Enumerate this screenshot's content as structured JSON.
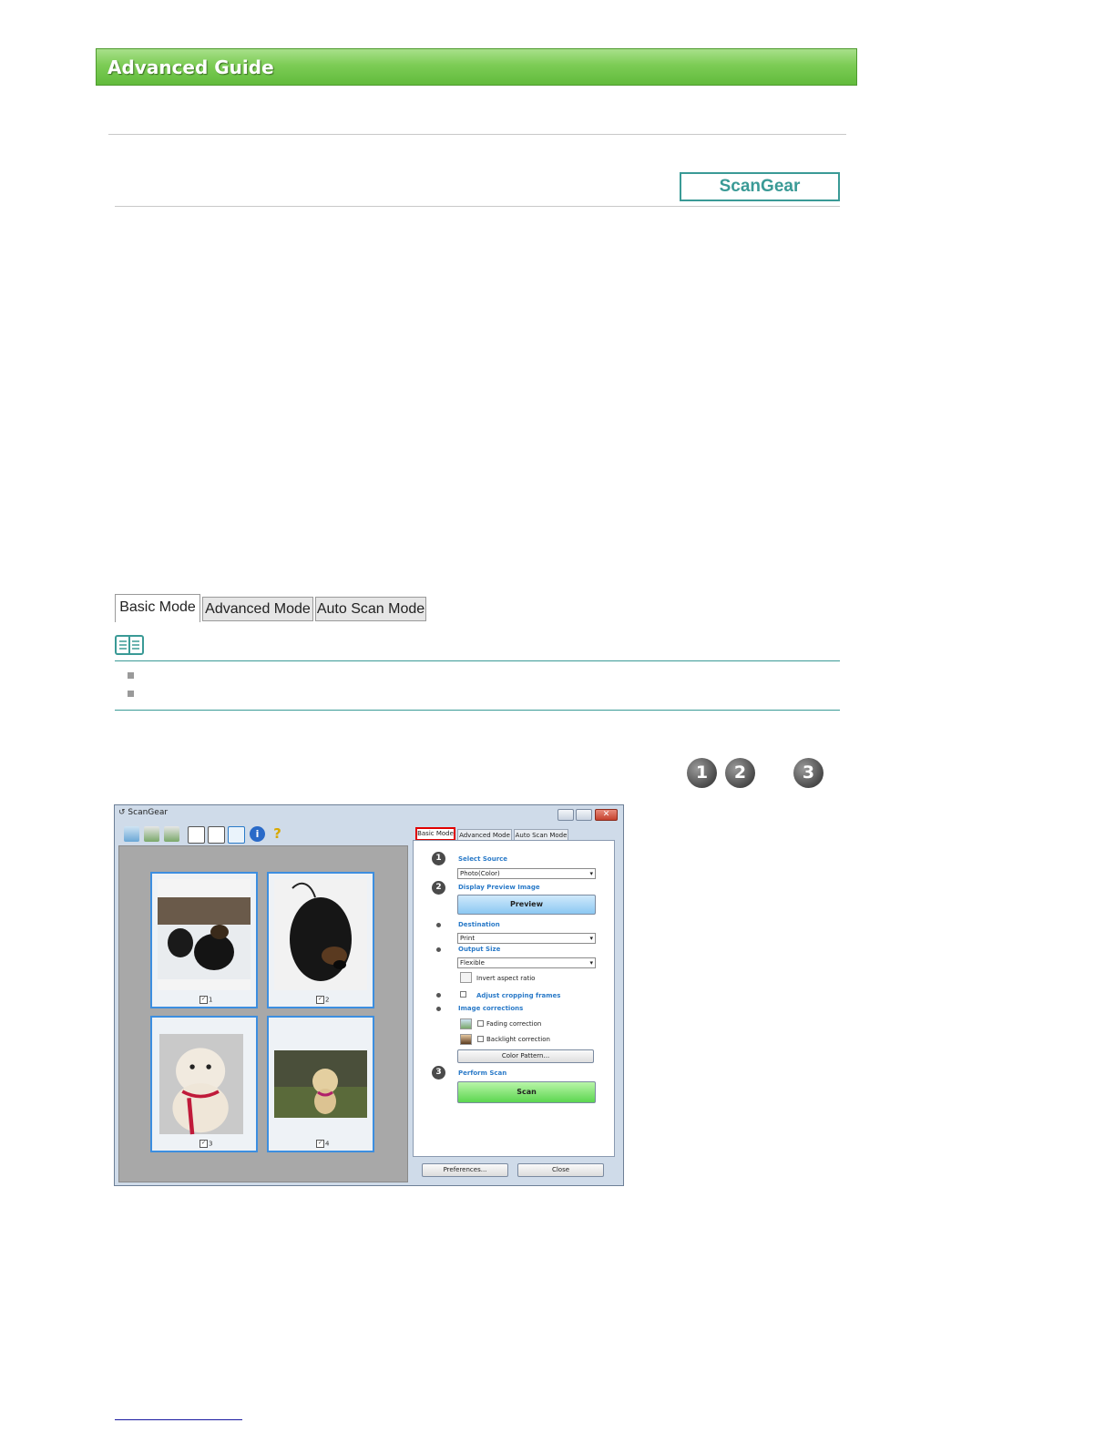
{
  "header": {
    "title": "Advanced Guide"
  },
  "badge": {
    "label": "ScanGear"
  },
  "tabs": [
    {
      "label": "Basic Mode"
    },
    {
      "label": "Advanced Mode"
    },
    {
      "label": "Auto Scan Mode"
    }
  ],
  "steps": [
    "1",
    "2",
    "3"
  ],
  "window": {
    "title": "ScanGear",
    "tabs": [
      "Basic Mode",
      "Advanced Mode",
      "Auto Scan Mode"
    ],
    "frames": [
      "1",
      "2",
      "3",
      "4"
    ],
    "panel": {
      "select_source": "Select Source",
      "source_value": "Photo(Color)",
      "display_preview": "Display Preview Image",
      "preview_btn": "Preview",
      "destination": "Destination",
      "destination_value": "Print",
      "output_size": "Output Size",
      "output_value": "Flexible",
      "invert": "Invert aspect ratio",
      "adjust": "Adjust cropping frames",
      "image_corrections": "Image corrections",
      "fading": "Fading correction",
      "backlight": "Backlight correction",
      "color_pattern": "Color Pattern...",
      "perform_scan": "Perform Scan",
      "scan_btn": "Scan",
      "preferences_btn": "Preferences...",
      "close_btn": "Close"
    }
  }
}
